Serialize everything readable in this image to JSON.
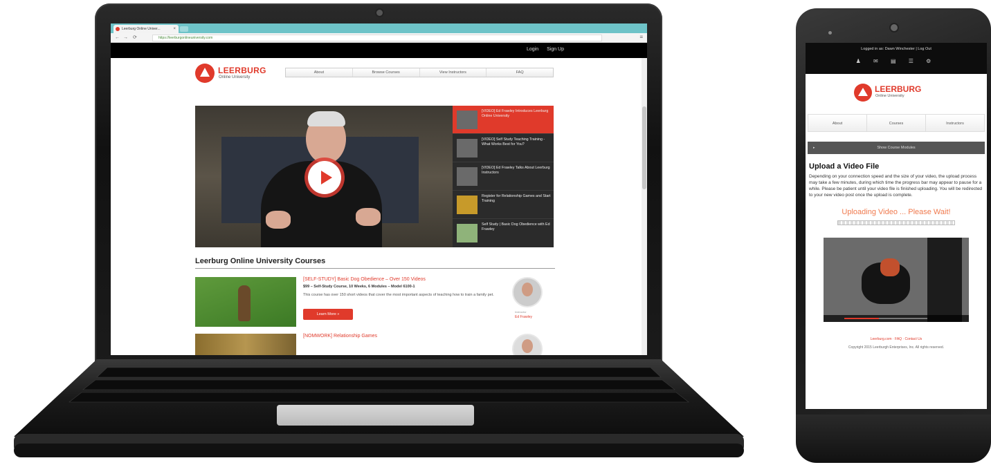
{
  "browser": {
    "tab_title": "Leerburg Online Univer...",
    "tab_close": "×",
    "url": "https://leerburgonlineuniversity.com",
    "back": "←",
    "forward": "→",
    "reload": "⟳",
    "menu": "≡"
  },
  "desktop": {
    "topbar": {
      "login": "Login",
      "signup": "Sign Up"
    },
    "logo": {
      "name": "LEERBURG",
      "sub": "Online University"
    },
    "nav": [
      "About",
      "Browse Courses",
      "View Instructors",
      "FAQ"
    ],
    "playlist": [
      "[VIDEO] Ed Frawley Introduces Leerburg Online University",
      "[VIDEO] Self Study Teaching Training - What Works Best for You?",
      "[VIDEO] Ed Frawley Talks About Leerburg Instructors",
      "Register for Relationship Games and Start Training",
      "Self Study | Basic Dog Obedience with Ed Frawley"
    ],
    "courses_heading": "Leerburg Online University Courses",
    "course1": {
      "title": "[SELF-STUDY] Basic Dog Obedience – Over 150 Videos",
      "meta": "$99 – Self-Study Course, 10 Weeks, 6 Modules – Model 6100-1",
      "desc": "This course has over 150 short videos that cover the most important aspects of teaching how to train a family pet.",
      "button": "Learn More »",
      "instructor_role": "Instructor",
      "instructor_name": "Ed Frawley"
    },
    "course2": {
      "title": "[NOMWORK] Relationship Games"
    }
  },
  "mobile": {
    "logged_in": "Logged in as: Dawn Winchester | Log Out",
    "icons": "♟ ✉ ▤ ☰ ⚙",
    "logo": {
      "name": "LEERBURG",
      "sub": "Online University"
    },
    "nav": [
      "About",
      "Courses",
      "Instructors"
    ],
    "bar": "Show Course Modules",
    "bar_caret": "▸",
    "heading": "Upload a Video File",
    "paragraph": "Depending on your connection speed and the size of your video, the upload process may take a few minutes, during which time the progress bar may appear to pause for a while. Please be patient until your video file is finished uploading. You will be redirected to your new video post once the upload is complete.",
    "uploading": "Uploading Video ... Please Wait!",
    "footer_links": "Leerburg.com  ·  FAQ  ·  Contact Us",
    "copyright": "Copyright 2015 Leerburgh Enterprises, Inc. All rights reserved."
  },
  "colors": {
    "brand_red": "#e03a2b",
    "tab_teal": "#6ec3c8"
  }
}
